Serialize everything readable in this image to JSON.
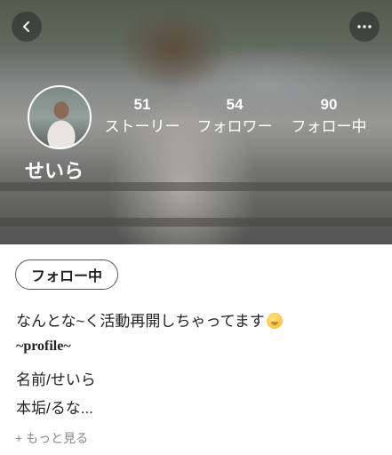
{
  "header": {
    "username": "せいら",
    "back_icon": "chevron-left-icon",
    "more_icon": "more-horizontal-icon"
  },
  "stats": [
    {
      "value": "51",
      "label": "ストーリー"
    },
    {
      "value": "54",
      "label": "フォロワー"
    },
    {
      "value": "90",
      "label": "フォロー中"
    }
  ],
  "profile": {
    "follow_label": "フォロー中",
    "bio_lines": [
      "なんとな~く活動再開しちゃってます",
      "~profile~",
      "名前/せいら",
      "本垢/るな..."
    ],
    "more_link": "+ もっと見る"
  }
}
